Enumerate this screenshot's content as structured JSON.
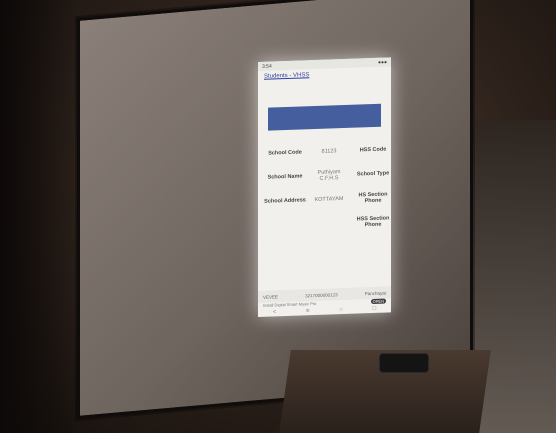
{
  "phone_screen": {
    "status_bar": {
      "left": "3:54",
      "right": "●●●"
    },
    "page_title": "Students - VHSS",
    "table": {
      "rows": [
        {
          "label": "School Code",
          "value": "81123",
          "right_label": "HSS Code"
        },
        {
          "label": "School Name",
          "value": "Puthiyam C.F.H.S",
          "right_label": "School Type"
        },
        {
          "label": "School Address",
          "value": "KOTTAYAM",
          "right_label": "HS Section Phone"
        },
        {
          "label": "",
          "value": "",
          "right_label": "HSS Section Phone"
        }
      ]
    },
    "bottom_row": {
      "left": "VEVEE",
      "center": "3217000000123",
      "right": "Panchayat"
    },
    "ad_bar": {
      "text": "Install Digital Smart Music Pro",
      "button": "OPEN"
    },
    "nav_icons": [
      "back-icon",
      "menu-icon",
      "home-icon",
      "recents-icon"
    ]
  }
}
